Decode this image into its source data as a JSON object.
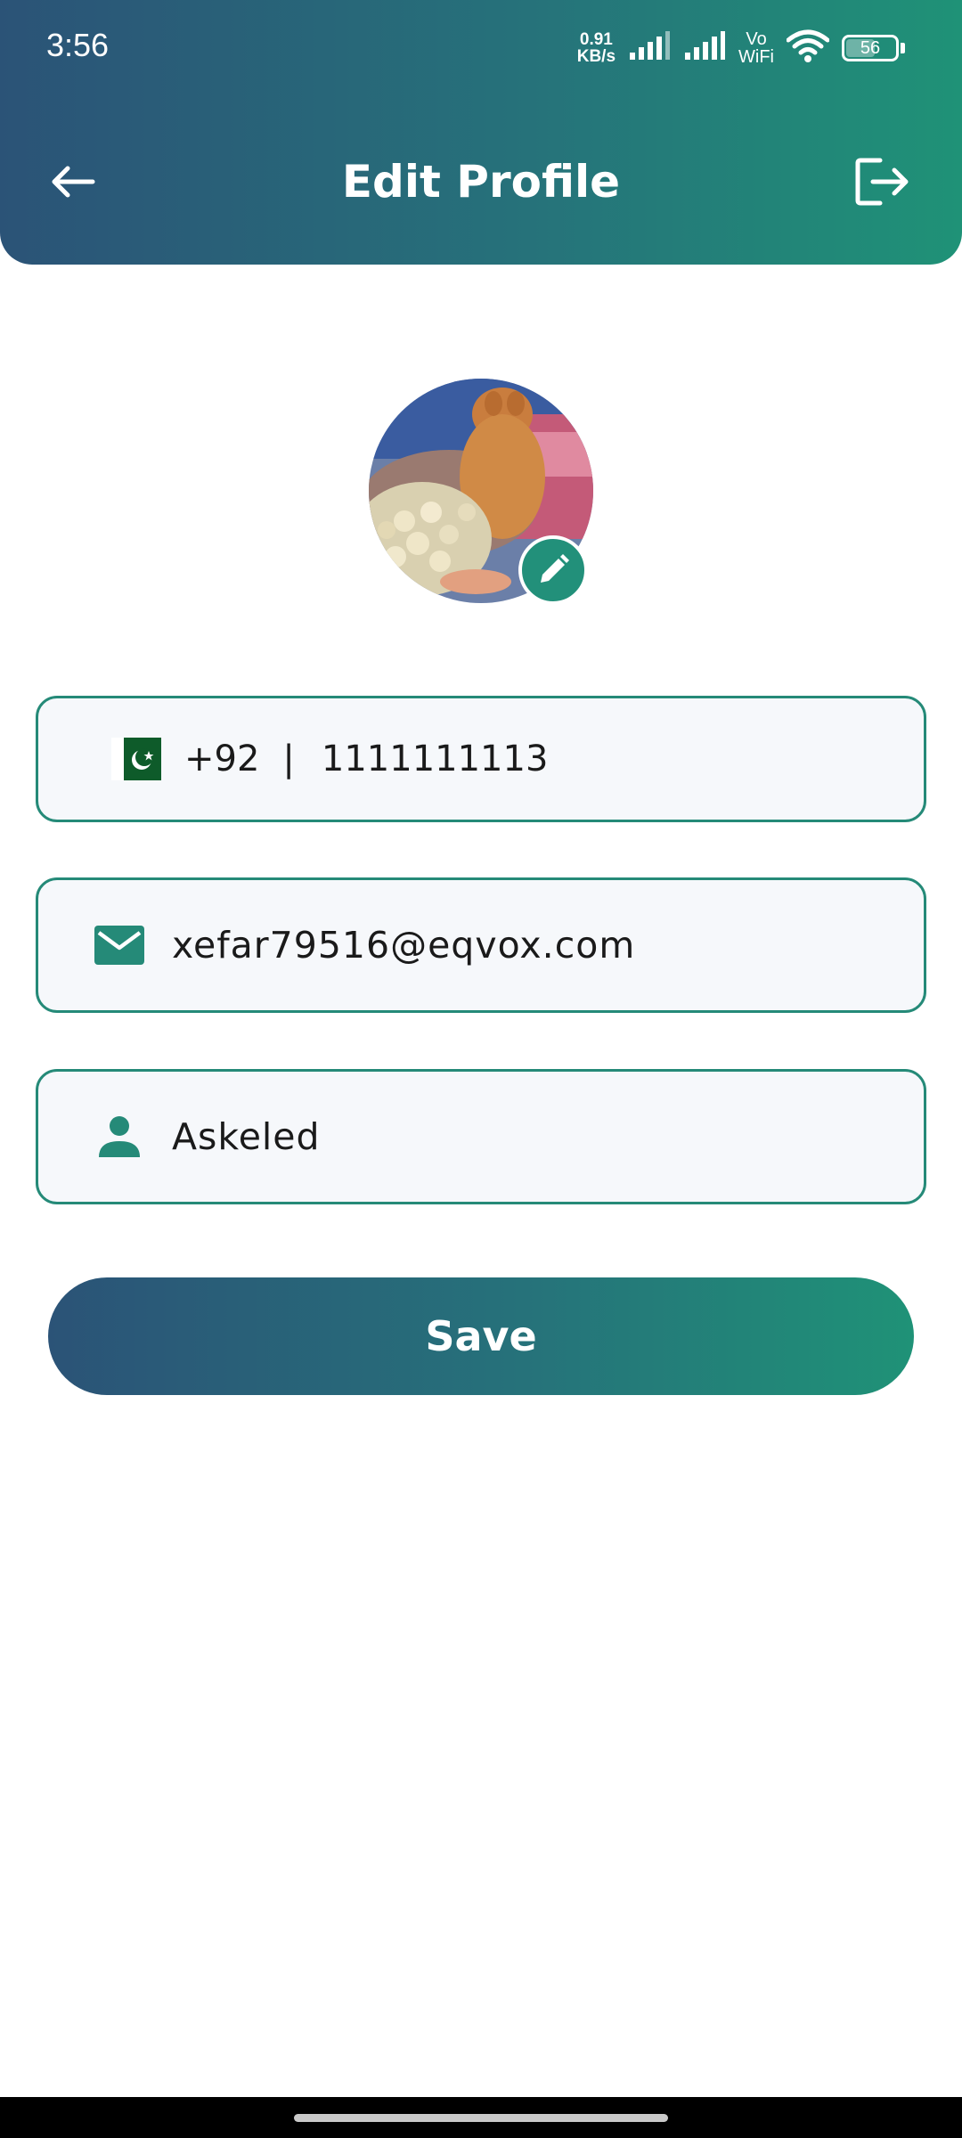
{
  "status_bar": {
    "time": "3:56",
    "net_speed_value": "0.91",
    "net_speed_unit": "KB/s",
    "vowifi_top": "Vo",
    "vowifi_bottom": "WiFi",
    "battery_level": "56",
    "battery_fraction": 0.56,
    "icons": [
      "signal-icon",
      "signal-icon",
      "wifi-icon",
      "battery-icon"
    ]
  },
  "header": {
    "title": "Edit Profile",
    "back_icon": "arrow-left-icon",
    "logout_icon": "logout-icon"
  },
  "profile": {
    "avatar_description_icon": "avatar",
    "edit_icon": "pencil-icon"
  },
  "form": {
    "phone": {
      "flag_icon": "pakistan-flag-icon",
      "country_code": "+92",
      "separator": "|",
      "number": "1111111113"
    },
    "email": {
      "icon": "mail-icon",
      "value": "xefar79516@eqvox.com"
    },
    "name": {
      "icon": "person-icon",
      "value": "Askeled"
    },
    "save_label": "Save"
  },
  "colors": {
    "header_start": "#2b5377",
    "header_end": "#1f9277",
    "accent": "#258a78",
    "field_bg": "#f6f8fb"
  }
}
